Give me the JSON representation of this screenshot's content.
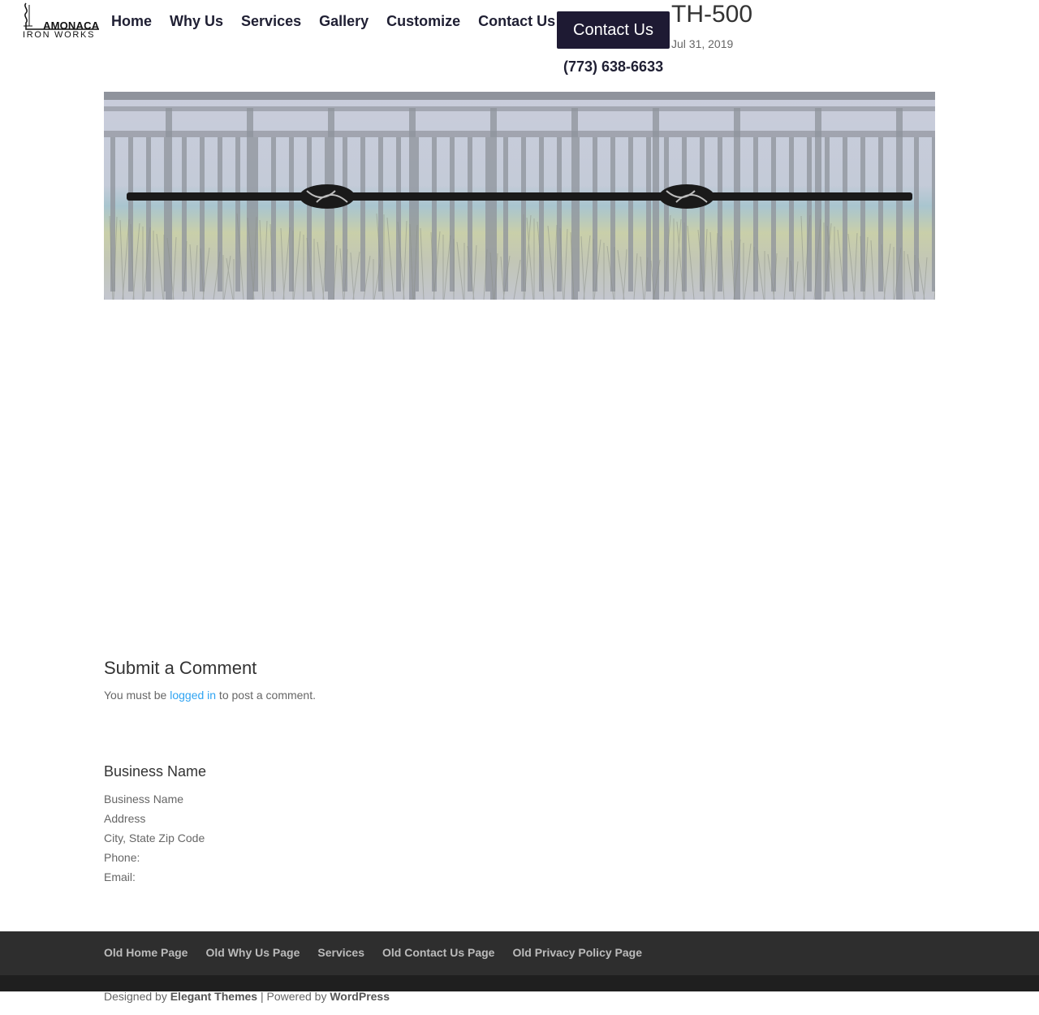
{
  "logo": {
    "text_top": "AMONACA",
    "text_bottom": "IRON WORKS",
    "initial": "L"
  },
  "nav": {
    "items": [
      {
        "label": "Home"
      },
      {
        "label": "Why Us"
      },
      {
        "label": "Services"
      },
      {
        "label": "Gallery"
      },
      {
        "label": "Customize"
      },
      {
        "label": "Contact Us"
      }
    ],
    "cta_label": "Contact Us",
    "phone": "(773) 638-6633"
  },
  "post": {
    "title": "TH-500",
    "date": "Jul 31, 2019"
  },
  "hero": {
    "image_desc": "railing",
    "bg_color": "#c5cad6",
    "bar_color": "#1a1a1a"
  },
  "comments": {
    "title": "Submit a Comment",
    "note_pre": "You must be ",
    "note_link": "logged in",
    "note_post": " to post a comment."
  },
  "business": {
    "title": "Business Name",
    "lines": [
      "Business Name",
      "Address",
      "City, State Zip Code",
      "Phone:",
      "Email:"
    ]
  },
  "footer": {
    "links": [
      {
        "label": "Old Home Page"
      },
      {
        "label": "Old Why Us Page"
      },
      {
        "label": "Services"
      },
      {
        "label": "Old Contact Us Page"
      },
      {
        "label": "Old Privacy Policy Page"
      }
    ],
    "credits_pre": "Designed by ",
    "credits_brand": "Elegant Themes",
    "credits_mid": " | Powered by ",
    "credits_platform": "WordPress"
  },
  "colors": {
    "accent": "#2ea3f2",
    "cta_bg": "#1e1a33",
    "footer_bg": "#2e2e2e",
    "footer_bottom_bg": "#1f1f1f"
  }
}
